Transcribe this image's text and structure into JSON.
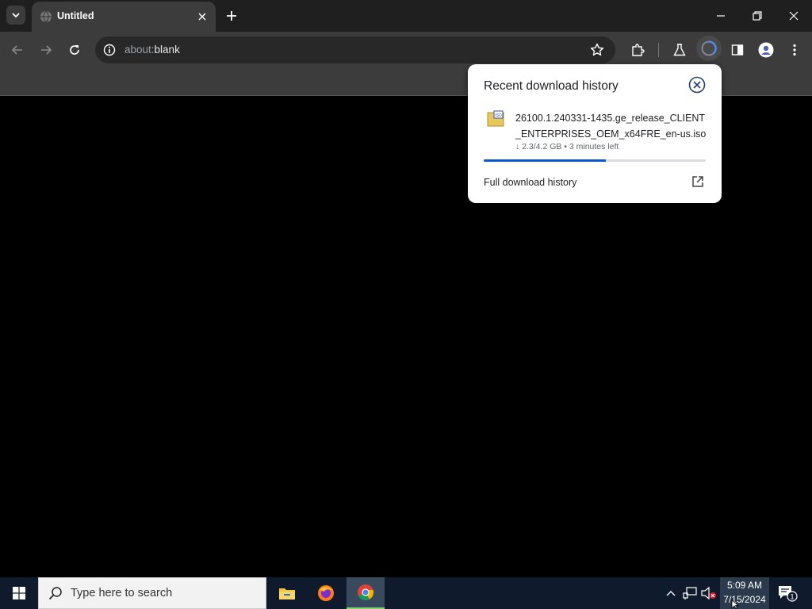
{
  "browser": {
    "tab": {
      "title": "Untitled"
    },
    "address": {
      "scheme": "about:",
      "path": "blank"
    }
  },
  "downloads": {
    "title": "Recent download history",
    "item": {
      "filename": "26100.1.240331-1435.ge_release_CLIENT_ENTERPRISES_OEM_x64FRE_en-us.iso",
      "status": "↓ 2.3/4.2 GB • 3 minutes left",
      "progress_fraction": 0.55,
      "file_badge": "ISO"
    },
    "full_history_label": "Full download history"
  },
  "taskbar": {
    "search_placeholder": "Type here to search",
    "time": "5:09 AM",
    "date": "7/15/2024",
    "notification_count": "1"
  },
  "colors": {
    "accent_blue": "#0b57d0",
    "taskbar_bg": "#0f1b2d"
  }
}
